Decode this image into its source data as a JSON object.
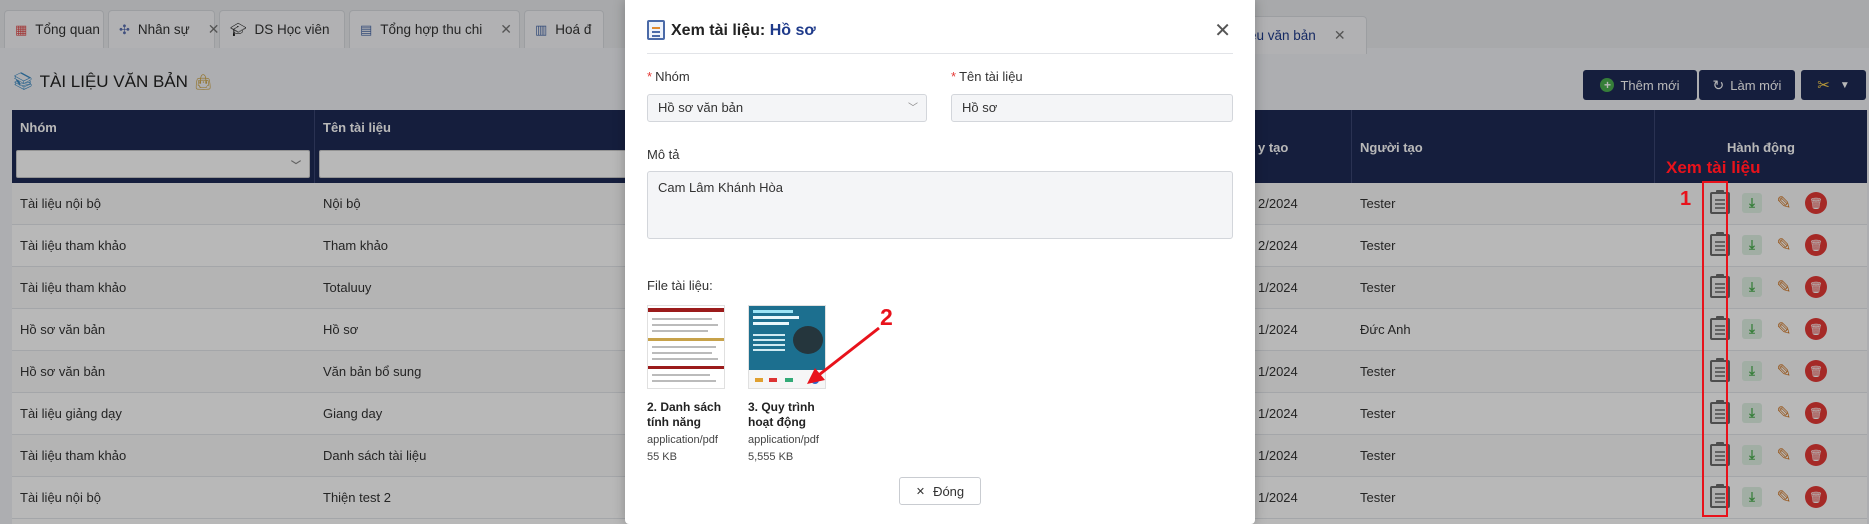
{
  "tabs": [
    {
      "label": "Tổng quan",
      "icon": "grid-icon",
      "closable": false
    },
    {
      "label": "Nhân sự",
      "icon": "people-icon",
      "closable": true
    },
    {
      "label": "DS Học viên",
      "icon": "graduation-cap-icon",
      "closable": true
    },
    {
      "label": "Tổng hợp thu chi",
      "icon": "document-icon",
      "closable": true
    },
    {
      "label": "Hoá đ",
      "icon": "receipt-icon",
      "closable": false
    },
    {
      "label": "liệu văn bản",
      "icon": "",
      "closable": true
    }
  ],
  "page": {
    "title": "TÀI LIỆU VĂN BẢN",
    "add_label": "Thêm mới",
    "refresh_label": "Làm mới"
  },
  "table": {
    "headers": {
      "group": "Nhóm",
      "name": "Tên tài liệu",
      "created_date": "y tạo",
      "creator": "Người tạo",
      "actions": "Hành động"
    },
    "rows": [
      {
        "group": "Tài liệu nội bộ",
        "name": "Nội bộ",
        "date": "2/2024",
        "creator": "Tester"
      },
      {
        "group": "Tài liệu tham khảo",
        "name": "Tham khảo",
        "date": "2/2024",
        "creator": "Tester"
      },
      {
        "group": "Tài liệu tham khảo",
        "name": "Totaluuy",
        "date": "1/2024",
        "creator": "Tester"
      },
      {
        "group": "Hồ sơ văn bản",
        "name": "Hồ sơ",
        "date": "1/2024",
        "creator": "Đức Anh"
      },
      {
        "group": "Hồ sơ văn bản",
        "name": "Văn bản bổ sung",
        "date": "1/2024",
        "creator": "Tester"
      },
      {
        "group": "Tài liệu giảng dạy",
        "name": "Giang day",
        "date": "1/2024",
        "creator": "Tester"
      },
      {
        "group": "Tài liệu tham khảo",
        "name": "Danh sách tài liệu",
        "date": "1/2024",
        "creator": "Tester"
      },
      {
        "group": "Tài liệu nội bộ",
        "name": "Thiện test 2",
        "date": "1/2024",
        "creator": "Tester"
      }
    ]
  },
  "annotations": {
    "view_label": "Xem tài liệu",
    "num1": "1",
    "num2": "2"
  },
  "modal": {
    "title_prefix": "Xem tài liệu:",
    "title_value": "Hồ sơ",
    "group_label": "Nhóm",
    "group_value": "Hồ sơ văn bản",
    "name_label": "Tên tài liệu",
    "name_value": "Hồ sơ",
    "desc_label": "Mô tả",
    "desc_value": "Cam Lâm Khánh Hòa",
    "files_label": "File tài liệu:",
    "files": [
      {
        "name_line1": "2. Danh sách",
        "name_line2": "tính năng",
        "type": "application/pdf",
        "size": "55 KB"
      },
      {
        "name_line1": "3. Quy trình",
        "name_line2": "hoạt động",
        "type": "application/pdf",
        "size": "5,555 KB"
      }
    ],
    "close_label": "Đóng"
  },
  "colors": {
    "header_bg": "#1e2a55",
    "accent_red": "#e8121b",
    "delete_red": "#e53935",
    "download_green": "#4caf50"
  }
}
